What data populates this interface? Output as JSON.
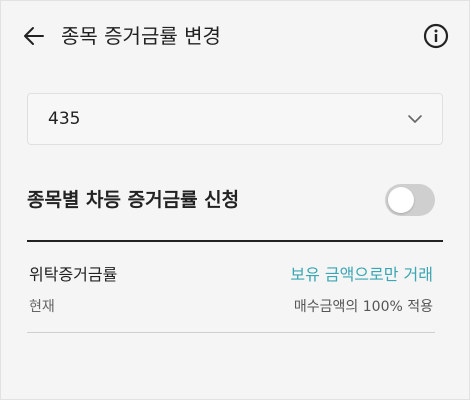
{
  "header": {
    "title": "종목 증거금률 변경",
    "back_icon": "arrow-left-icon",
    "info_icon": "info-circle-icon"
  },
  "select": {
    "value": "435",
    "icon": "chevron-down-icon"
  },
  "toggle": {
    "label": "종목별 차등 증거금률 신청",
    "state": "off"
  },
  "margin_info": {
    "label": "위탁증거금률",
    "link_text": "보유 금액으로만 거래",
    "current_label": "현재",
    "current_value": "매수금액의 100% 적용"
  },
  "colors": {
    "accent": "#3aa6b3",
    "background": "#f5f5f5",
    "toggle_off": "#cfcfcf"
  }
}
